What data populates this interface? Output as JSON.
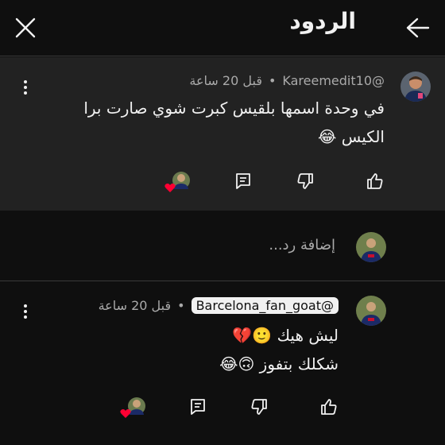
{
  "header": {
    "title": "الردود"
  },
  "top_comment": {
    "author": "@Kareemedit10",
    "time": "قبل 20 ساعة",
    "separator": "•",
    "text_line1": "في وحدة اسمها بلقيس كبرت شوي صارت برا",
    "text_line2": "الكيس 😂"
  },
  "reply_box": {
    "placeholder": "إضافة رد..."
  },
  "reply": {
    "author": "@Barcelona_fan_goat",
    "time": "قبل 20 ساعة",
    "separator": "•",
    "text_line1": "ليش هيك 🙂💔",
    "text_line2": "شكلك بتفوز 🙃😂"
  },
  "colors": {
    "background": "#0f0f0f",
    "highlight": "#222222",
    "heart": "#ff0033",
    "text": "#f1f1f1",
    "muted": "#aaaaaa"
  }
}
